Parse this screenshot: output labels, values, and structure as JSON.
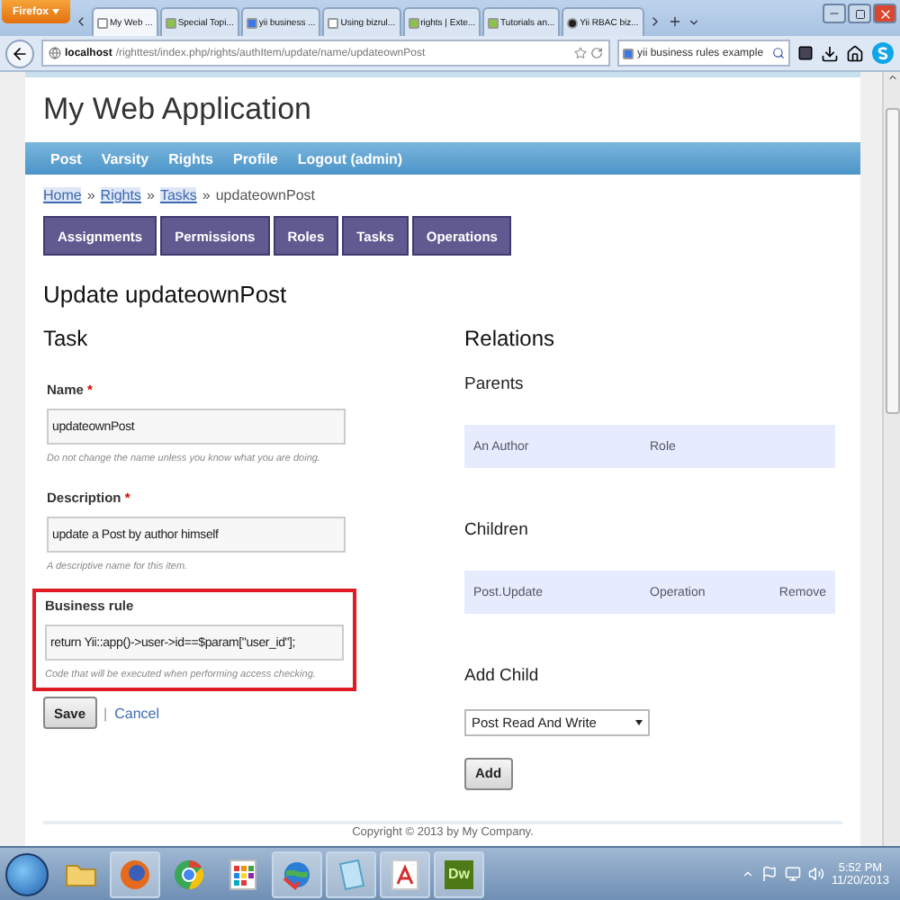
{
  "browser": {
    "menu_button": "Firefox",
    "tabs": [
      {
        "title": "My Web ...",
        "kind": "blank",
        "selected": true
      },
      {
        "title": "Special Topi...",
        "kind": "yii",
        "selected": false
      },
      {
        "title": "yii business ...",
        "kind": "google",
        "selected": false
      },
      {
        "title": "Using bizrul...",
        "kind": "blank",
        "selected": false
      },
      {
        "title": "rights | Exte...",
        "kind": "yii",
        "selected": false
      },
      {
        "title": "Tutorials an...",
        "kind": "yii",
        "selected": false
      },
      {
        "title": "Yii RBAC biz...",
        "kind": "github",
        "selected": false
      }
    ],
    "url_host": "localhost",
    "url_path": "/righttest/index.php/rights/authItem/update/name/updateownPost",
    "search": "yii business rules example"
  },
  "app_title": "My Web Application",
  "menu": [
    "Post",
    "Varsity",
    "Rights",
    "Profile",
    "Logout (admin)"
  ],
  "breadcrumbs": [
    {
      "label": "Home",
      "link": true
    },
    {
      "label": "Rights",
      "link": true
    },
    {
      "label": "Tasks",
      "link": true
    },
    {
      "label": "updateownPost",
      "link": false
    }
  ],
  "breadcrumb_separator": "»",
  "tabs": [
    "Assignments",
    "Permissions",
    "Roles",
    "Tasks",
    "Operations"
  ],
  "heading": "Update updateownPost",
  "task": {
    "title": "Task",
    "fields": [
      {
        "label": "Name",
        "marker": "*",
        "value": "updateownPost",
        "hint": "Do not change the name unless you know what you are doing.",
        "highlighted": false
      },
      {
        "label": "Description",
        "marker": "*",
        "value": "update a Post by author himself",
        "hint": "A descriptive name for this item.",
        "highlighted": false
      },
      {
        "label": "Business rule",
        "value": "return Yii::app()->user->id==$param[\"user_id\"];",
        "hint": "Code that will be executed when performing access checking.",
        "highlighted": true
      }
    ],
    "save": "Save",
    "separator": "|",
    "cancel": "Cancel"
  },
  "relations": {
    "title": "Relations",
    "parents": {
      "title": "Parents",
      "rows": [
        {
          "name": "An Author",
          "type": "Role"
        }
      ]
    },
    "children": {
      "title": "Children",
      "rows": [
        {
          "name": "Post.Update",
          "type": "Operation",
          "action": "Remove"
        }
      ]
    },
    "add_child": {
      "title": "Add Child",
      "selected": "Post Read And Write",
      "button": "Add"
    }
  },
  "footer": "Copyright © 2013 by My Company.",
  "taskbar": {
    "apps": [
      {
        "kind": "folder",
        "active": false
      },
      {
        "kind": "firefox",
        "active": true
      },
      {
        "kind": "chrome",
        "active": false
      },
      {
        "kind": "grid",
        "active": false
      },
      {
        "kind": "globe",
        "active": true
      },
      {
        "kind": "notepad",
        "active": true
      },
      {
        "kind": "pdf",
        "active": true
      },
      {
        "kind": "dw",
        "label": "Dw",
        "active": true
      }
    ],
    "time": "5:52 PM",
    "date": "11/20/2013"
  }
}
